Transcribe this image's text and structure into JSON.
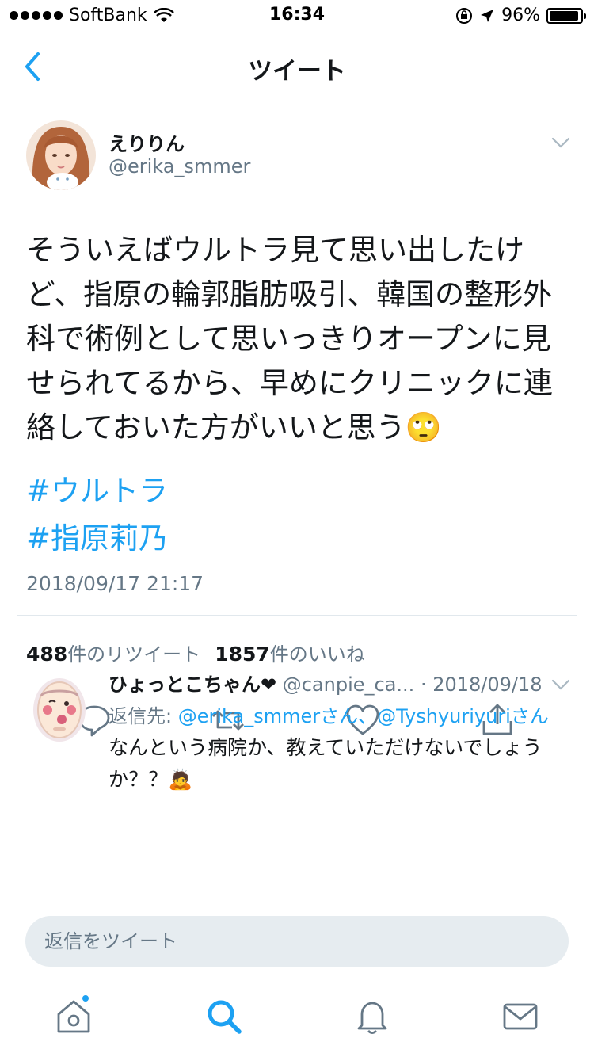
{
  "status_bar": {
    "carrier": "SoftBank",
    "time": "16:34",
    "battery_percent": "96%",
    "battery_level": 0.96
  },
  "nav": {
    "title": "ツイート",
    "back_icon": "chevron-left-icon"
  },
  "tweet": {
    "display_name": "えりりん",
    "handle": "@erika_smmer",
    "text": "そういえばウルトラ見て思い出したけど、指原の輪郭脂肪吸引、韓国の整形外科で術例として思いっきりオープンに見せられてるから、早めにクリニックに連絡しておいた方がいいと思う🙄",
    "hashtags": [
      "#ウルトラ",
      "#指原莉乃"
    ],
    "timestamp": "2018/09/17 21:17",
    "retweet_count": "488",
    "retweet_label": "件のリツイート",
    "like_count": "1857",
    "like_label": "件のいいね",
    "actions": [
      "reply-icon",
      "retweet-icon",
      "like-icon",
      "share-icon"
    ]
  },
  "reply": {
    "display_name": "ひょっとこちゃん❤",
    "handle_date": " @canpie_ca... · 2018/09/18",
    "to_prefix": "返信先: ",
    "to_user1": "@erika_smmerさん",
    "to_sep": "、",
    "to_user2": "@Tyshyuriyuriさん",
    "text": "なんという病院か、教えていただけないでしょうか？？🙇"
  },
  "reply_box": {
    "placeholder": "返信をツイート"
  },
  "tabbar": {
    "tabs": [
      "home-icon",
      "search-icon",
      "notifications-icon",
      "messages-icon"
    ],
    "active_color": "#1da1f2",
    "inactive_color": "#657786"
  }
}
